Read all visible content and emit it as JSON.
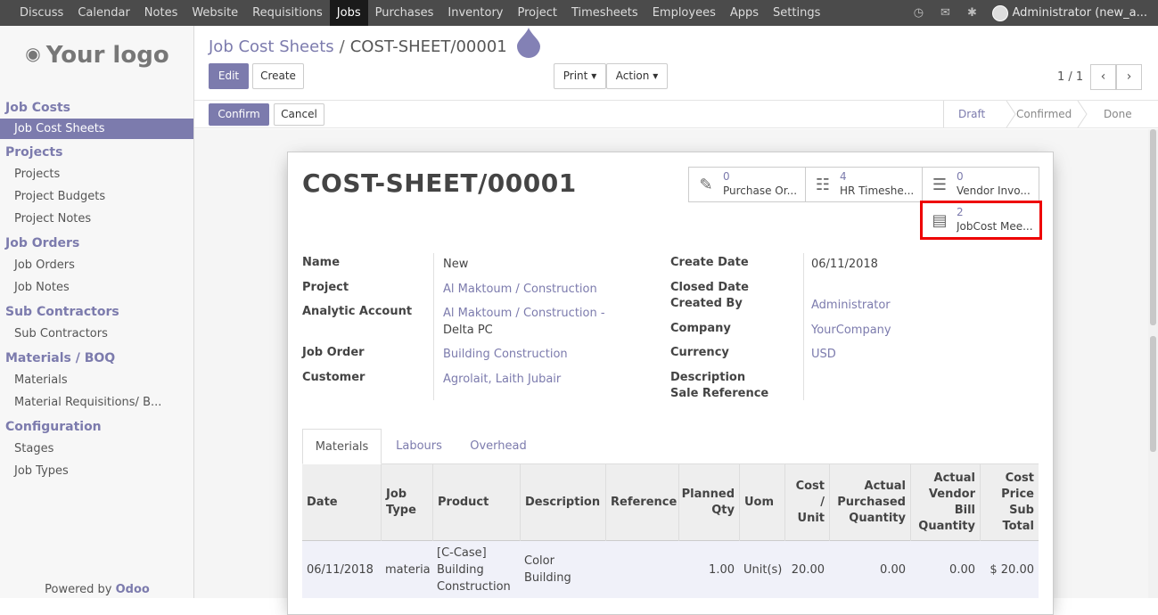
{
  "topbar": {
    "menu": [
      "Discuss",
      "Calendar",
      "Notes",
      "Website",
      "Requisitions",
      "Jobs",
      "Purchases",
      "Inventory",
      "Project",
      "Timesheets",
      "Employees",
      "Apps",
      "Settings"
    ],
    "active": "Jobs",
    "user": "Administrator (new_a..."
  },
  "sidebar": {
    "logo": "Your logo",
    "sections": [
      {
        "title": "Job Costs",
        "items": [
          "Job Cost Sheets"
        ]
      },
      {
        "title": "Projects",
        "items": [
          "Projects",
          "Project Budgets",
          "Project Notes"
        ]
      },
      {
        "title": "Job Orders",
        "items": [
          "Job Orders",
          "Job Notes"
        ]
      },
      {
        "title": "Sub Contractors",
        "items": [
          "Sub Contractors"
        ]
      },
      {
        "title": "Materials / BOQ",
        "items": [
          "Materials",
          "Material Requisitions/ B..."
        ]
      },
      {
        "title": "Configuration",
        "items": [
          "Stages",
          "Job Types"
        ]
      }
    ],
    "active_item": "Job Cost Sheets",
    "powered_prefix": "Powered by",
    "powered_brand": "Odoo"
  },
  "breadcrumb": {
    "parent": "Job Cost Sheets",
    "separator": "/",
    "current": "COST-SHEET/00001"
  },
  "buttons": {
    "edit": "Edit",
    "create": "Create",
    "print": "Print",
    "action": "Action",
    "confirm": "Confirm",
    "cancel": "Cancel"
  },
  "pager": {
    "text": "1 / 1"
  },
  "stages": [
    "Draft",
    "Confirmed",
    "Done"
  ],
  "current_stage": "Draft",
  "record": {
    "title": "COST-SHEET/00001",
    "smart_buttons": [
      {
        "count": "0",
        "label": "Purchase Or...",
        "icon": "edit-icon"
      },
      {
        "count": "4",
        "label": "HR Timeshe...",
        "icon": "book-icon"
      },
      {
        "count": "0",
        "label": "Vendor Invo...",
        "icon": "list-icon"
      },
      {
        "count": "2",
        "label": "JobCost Mee...",
        "icon": "tasks-icon"
      }
    ],
    "left_fields": {
      "name_label": "Name",
      "name": "New",
      "project_label": "Project",
      "project": "Al Maktoum / Construction",
      "analytic_label": "Analytic Account",
      "analytic_line1": "Al Maktoum / Construction -",
      "analytic_line2": "Delta PC",
      "job_order_label": "Job Order",
      "job_order": "Building Construction",
      "customer_label": "Customer",
      "customer": "Agrolait, Laith Jubair"
    },
    "right_fields": {
      "create_date_label": "Create Date",
      "create_date": "06/11/2018",
      "closed_date_label": "Closed Date",
      "created_by_label": "Created By",
      "created_by": "Administrator",
      "company_label": "Company",
      "company": "YourCompany",
      "currency_label": "Currency",
      "currency": "USD",
      "description_label": "Description",
      "sale_ref_label": "Sale Reference"
    }
  },
  "tabs": [
    "Materials",
    "Labours",
    "Overhead"
  ],
  "active_tab": "Materials",
  "table": {
    "headers": [
      "Date",
      "Job Type",
      "Product",
      "Description",
      "Reference",
      "Planned Qty",
      "Uom",
      "Cost / Unit",
      "Actual Purchased Quantity",
      "Actual Vendor Bill Quantity",
      "Cost Price Sub Total"
    ],
    "row": {
      "date": "06/11/2018",
      "job_type": "materia",
      "product_1": "[C-Case]",
      "product_2": "Building",
      "product_3": "Construction",
      "description_1": "Color",
      "description_2": "Building",
      "reference": "",
      "planned_qty": "1.00",
      "uom": "Unit(s)",
      "cost_unit": "20.00",
      "actual_purchased": "0.00",
      "actual_vendor_bill": "0.00",
      "subtotal": "$ 20.00"
    }
  },
  "colors": {
    "accent": "#7c7bad",
    "topbar": "#4b4b4b",
    "highlight": "#e00000"
  }
}
